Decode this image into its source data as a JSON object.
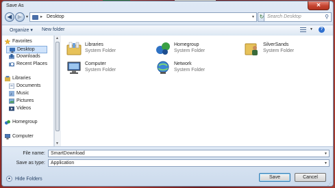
{
  "window": {
    "title": "Save As",
    "close_glyph": "✕"
  },
  "address_bar": {
    "path": "Desktop",
    "search_placeholder": "Search Desktop",
    "back_glyph": "◀",
    "forward_glyph": "▶",
    "refresh_glyph": "↻",
    "search_icon_glyph": "⚲"
  },
  "toolbar": {
    "organize": "Organize ▾",
    "new_folder": "New folder",
    "help": "?"
  },
  "sidebar": {
    "favorites": [
      {
        "label": "Favorites",
        "icon": "star-icon"
      },
      {
        "label": "Desktop",
        "icon": "desktop-icon",
        "selected": true
      },
      {
        "label": "Downloads",
        "icon": "downloads-icon"
      },
      {
        "label": "Recent Places",
        "icon": "recent-places-icon"
      }
    ],
    "libraries": [
      {
        "label": "Libraries",
        "icon": "libraries-icon"
      },
      {
        "label": "Documents",
        "icon": "documents-icon"
      },
      {
        "label": "Music",
        "icon": "music-icon"
      },
      {
        "label": "Pictures",
        "icon": "pictures-icon"
      },
      {
        "label": "Videos",
        "icon": "videos-icon"
      }
    ],
    "homegroup": {
      "label": "Homegroup",
      "icon": "homegroup-icon"
    },
    "computer": {
      "label": "Computer",
      "icon": "computer-icon"
    }
  },
  "items": [
    {
      "name": "Libraries",
      "type": "System Folder",
      "icon": "libraries-folder-icon"
    },
    {
      "name": "Homegroup",
      "type": "System Folder",
      "icon": "homegroup-icon"
    },
    {
      "name": "SilverSands",
      "type": "System Folder",
      "icon": "user-folder-icon"
    },
    {
      "name": "Computer",
      "type": "System Folder",
      "icon": "computer-icon"
    },
    {
      "name": "Network",
      "type": "System Folder",
      "icon": "network-icon"
    }
  ],
  "form": {
    "file_name_label": "File name:",
    "file_name_value": "SmartDownload",
    "save_as_type_label": "Save as type:",
    "save_as_type_value": "Application",
    "hide_folders": "Hide Folders",
    "save_button": "Save",
    "cancel_button": "Cancel"
  }
}
